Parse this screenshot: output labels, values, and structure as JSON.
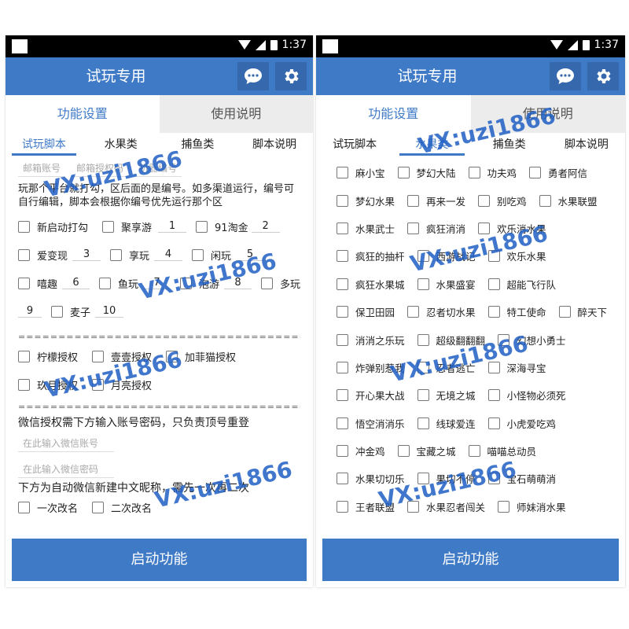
{
  "status_bar": {
    "time": "1:37"
  },
  "app": {
    "title": "试玩专用",
    "message_icon": "message-icon",
    "settings_icon": "gear-icon"
  },
  "tabs": [
    "功能设置",
    "使用说明"
  ],
  "subtabs": [
    "试玩脚本",
    "水果类",
    "捕鱼类",
    "脚本说明"
  ],
  "left": {
    "inputs": {
      "email": "邮箱账号",
      "email_code": "邮箱授权码",
      "device_no": "机器编号"
    },
    "note": "玩那个平台就打勾，区后面的是编号。如多渠道运行，编号可自行编辑，脚本会根据你编号优先运行那个区",
    "platforms": [
      {
        "label": "新启动打勾",
        "num": ""
      },
      {
        "label": "聚享游",
        "num": "1"
      },
      {
        "label": "91淘金",
        "num": "2"
      },
      {
        "label": "爱变现",
        "num": "3"
      },
      {
        "label": "享玩",
        "num": "4"
      },
      {
        "label": "闲玩",
        "num": "5"
      },
      {
        "label": "嘻趣",
        "num": "6"
      },
      {
        "label": "鱼玩",
        "num": "7"
      },
      {
        "label": "泡游",
        "num": "8"
      },
      {
        "label": "多玩",
        "num": "9"
      },
      {
        "label": "麦子",
        "num": "10"
      }
    ],
    "separator": "======================================",
    "auth": [
      "柠檬授权",
      "壹壹授权",
      "加菲猫授权",
      "玖月授权",
      "月亮授权"
    ],
    "wechat_note": "微信授权需下方输入账号密码，只负责顶号重登",
    "wechat_account_placeholder": "在此输入微信账号",
    "wechat_password_placeholder": "在此输入微信密码",
    "rename_note": "下方为自动微信新建中文昵称，需先一次再二次",
    "rename": [
      "一次改名",
      "二次改名"
    ]
  },
  "right": {
    "games": [
      [
        "麻小宝",
        "梦幻大陆",
        "功夫鸡",
        "勇者阿信"
      ],
      [
        "梦幻水果",
        "再来一发",
        "别吃鸡",
        "水果联盟"
      ],
      [
        "水果武士",
        "疯狂消消",
        "欢乐消水果"
      ],
      [
        "疯狂的抽杆",
        "西游战记",
        "欢乐水果"
      ],
      [
        "疯狂水果城",
        "水果盛宴",
        "超能飞行队"
      ],
      [
        "保卫田园",
        "忍者切水果",
        "特工使命",
        "醉天下"
      ],
      [
        "消消之乐玩",
        "超级翻翻翻",
        "幻想小勇士"
      ],
      [
        "炸弹别惹我",
        "忍者逃亡",
        "深海寻宝"
      ],
      [
        "开心果大战",
        "无境之城",
        "小怪物必须死"
      ],
      [
        "悟空消消乐",
        "线球爱连",
        "小虎爱吃鸡"
      ],
      [
        "冲金鸡",
        "宝藏之城",
        "喵喵总动员"
      ],
      [
        "水果切切乐",
        "果切不停",
        "宝石萌萌消"
      ],
      [
        "王者联盟",
        "水果忍者闯关",
        "师妹消水果"
      ]
    ]
  },
  "start_button": "启动功能",
  "watermark": "VX:uzi1866"
}
